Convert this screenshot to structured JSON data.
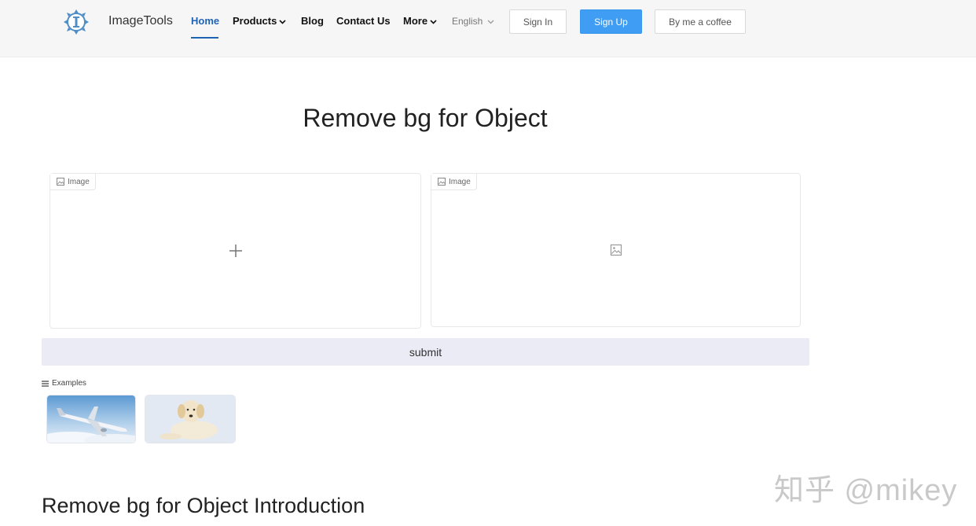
{
  "header": {
    "brand": "ImageTools",
    "nav": [
      "Home",
      "Products",
      "Blog",
      "Contact Us",
      "More"
    ],
    "active_nav": "Home",
    "language": "English",
    "sign_in": "Sign In",
    "sign_up": "Sign Up",
    "coffee": "By me a coffee"
  },
  "main": {
    "title": "Remove bg for Object",
    "input_panel_label": "Image",
    "output_panel_label": "Image",
    "submit_label": "submit",
    "examples_label": "Examples",
    "examples": [
      "airplane-thumbnail",
      "dog-thumbnail"
    ],
    "intro_heading": "Remove bg for Object Introduction"
  },
  "watermark": "知乎 @mikey",
  "colors": {
    "accent": "#1f63b5",
    "primary_button": "#3f9ef3",
    "submit_bg": "#eaebf5",
    "header_bg": "#f6f6f7"
  }
}
